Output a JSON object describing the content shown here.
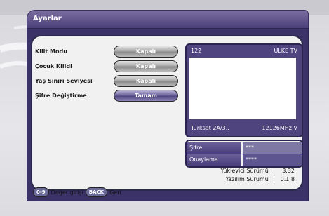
{
  "title": "Ayarlar",
  "settings": [
    {
      "label": "Kilit Modu",
      "value": "Kapalı",
      "active": false
    },
    {
      "label": "Çocuk Kilidi",
      "value": "Kapalı",
      "active": false
    },
    {
      "label": "Yaş Sınırı Seviyesi",
      "value": "Kapalı",
      "active": false
    },
    {
      "label": "Şifre Değiştirme",
      "value": "Tamam",
      "active": true
    }
  ],
  "preview": {
    "channel_number": "122",
    "channel_name": "ULKE TV",
    "satellite": "Turksat 2A/3..",
    "frequency": "12126MHz V"
  },
  "password": {
    "sifre_label": "Şifre",
    "sifre_value": "***",
    "onaylama_label": "Onaylama",
    "onaylama_value": "****"
  },
  "versions": {
    "loader_label": "Yükleyici Sürümü :",
    "loader_value": "3.32",
    "software_label": "Yazılım Sürümü :",
    "software_value": "0.1.8"
  },
  "statusbar": {
    "key1": "0-9",
    "text1": "Değer girişi",
    "key2": "BACK",
    "text2": "Geri"
  }
}
